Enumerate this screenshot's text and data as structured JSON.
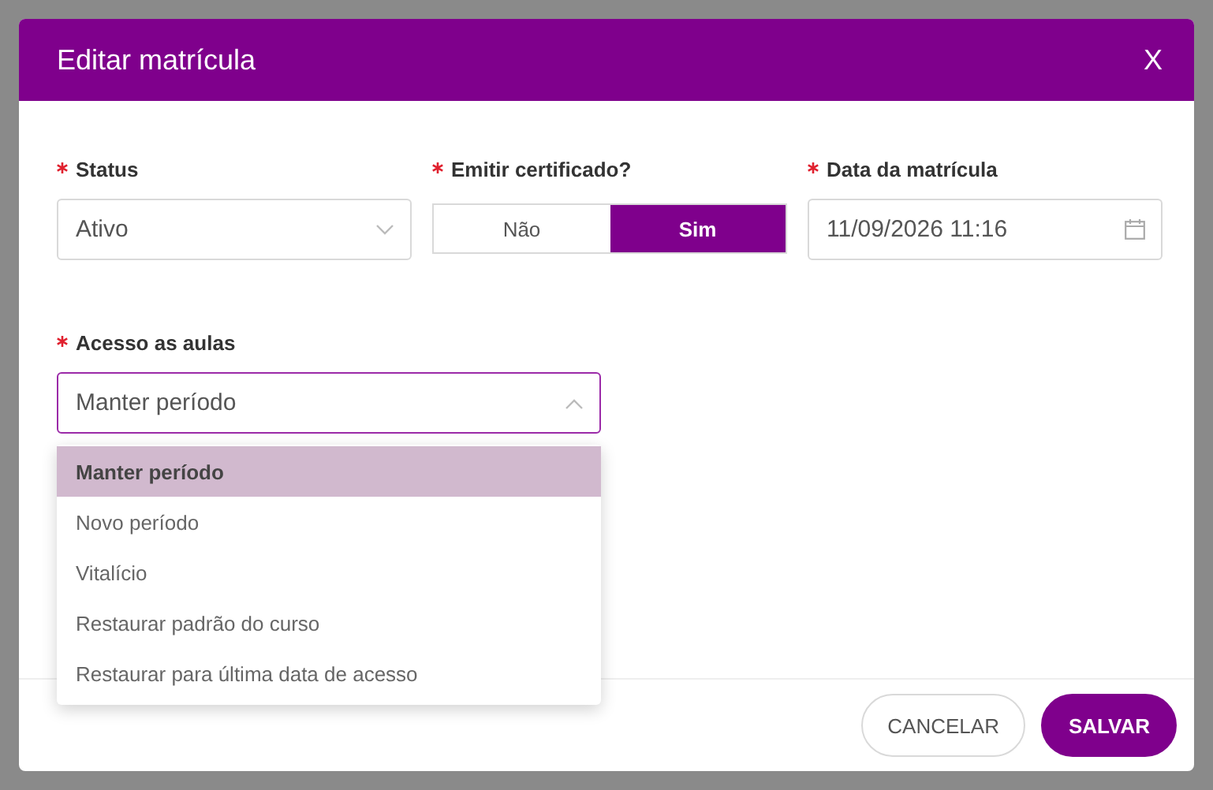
{
  "dialog": {
    "title": "Editar matrícula",
    "close": "X"
  },
  "fields": [
    {
      "kind": "select",
      "label": "Status",
      "required": true,
      "value": "Ativo"
    },
    {
      "kind": "toggle",
      "label": "Emitir certificado?",
      "required": true,
      "options": [
        {
          "label": "Não",
          "selected": false
        },
        {
          "label": "Sim",
          "selected": true
        }
      ]
    },
    {
      "kind": "date",
      "label": "Data da matrícula",
      "required": true,
      "value": "11/09/2026 11:16"
    }
  ],
  "access": {
    "label": "Acesso as aulas",
    "required": true,
    "value": "Manter período",
    "expanded": true,
    "options": [
      {
        "label": "Manter período",
        "selected": true
      },
      {
        "label": "Novo período",
        "selected": false
      },
      {
        "label": "Vitalício",
        "selected": false
      },
      {
        "label": "Restaurar padrão do curso",
        "selected": false
      },
      {
        "label": "Restaurar para última data de acesso",
        "selected": false
      }
    ]
  },
  "buttons": [
    {
      "kind": "secondary",
      "label": "CANCELAR"
    },
    {
      "kind": "primary",
      "label": "SALVAR"
    }
  ]
}
